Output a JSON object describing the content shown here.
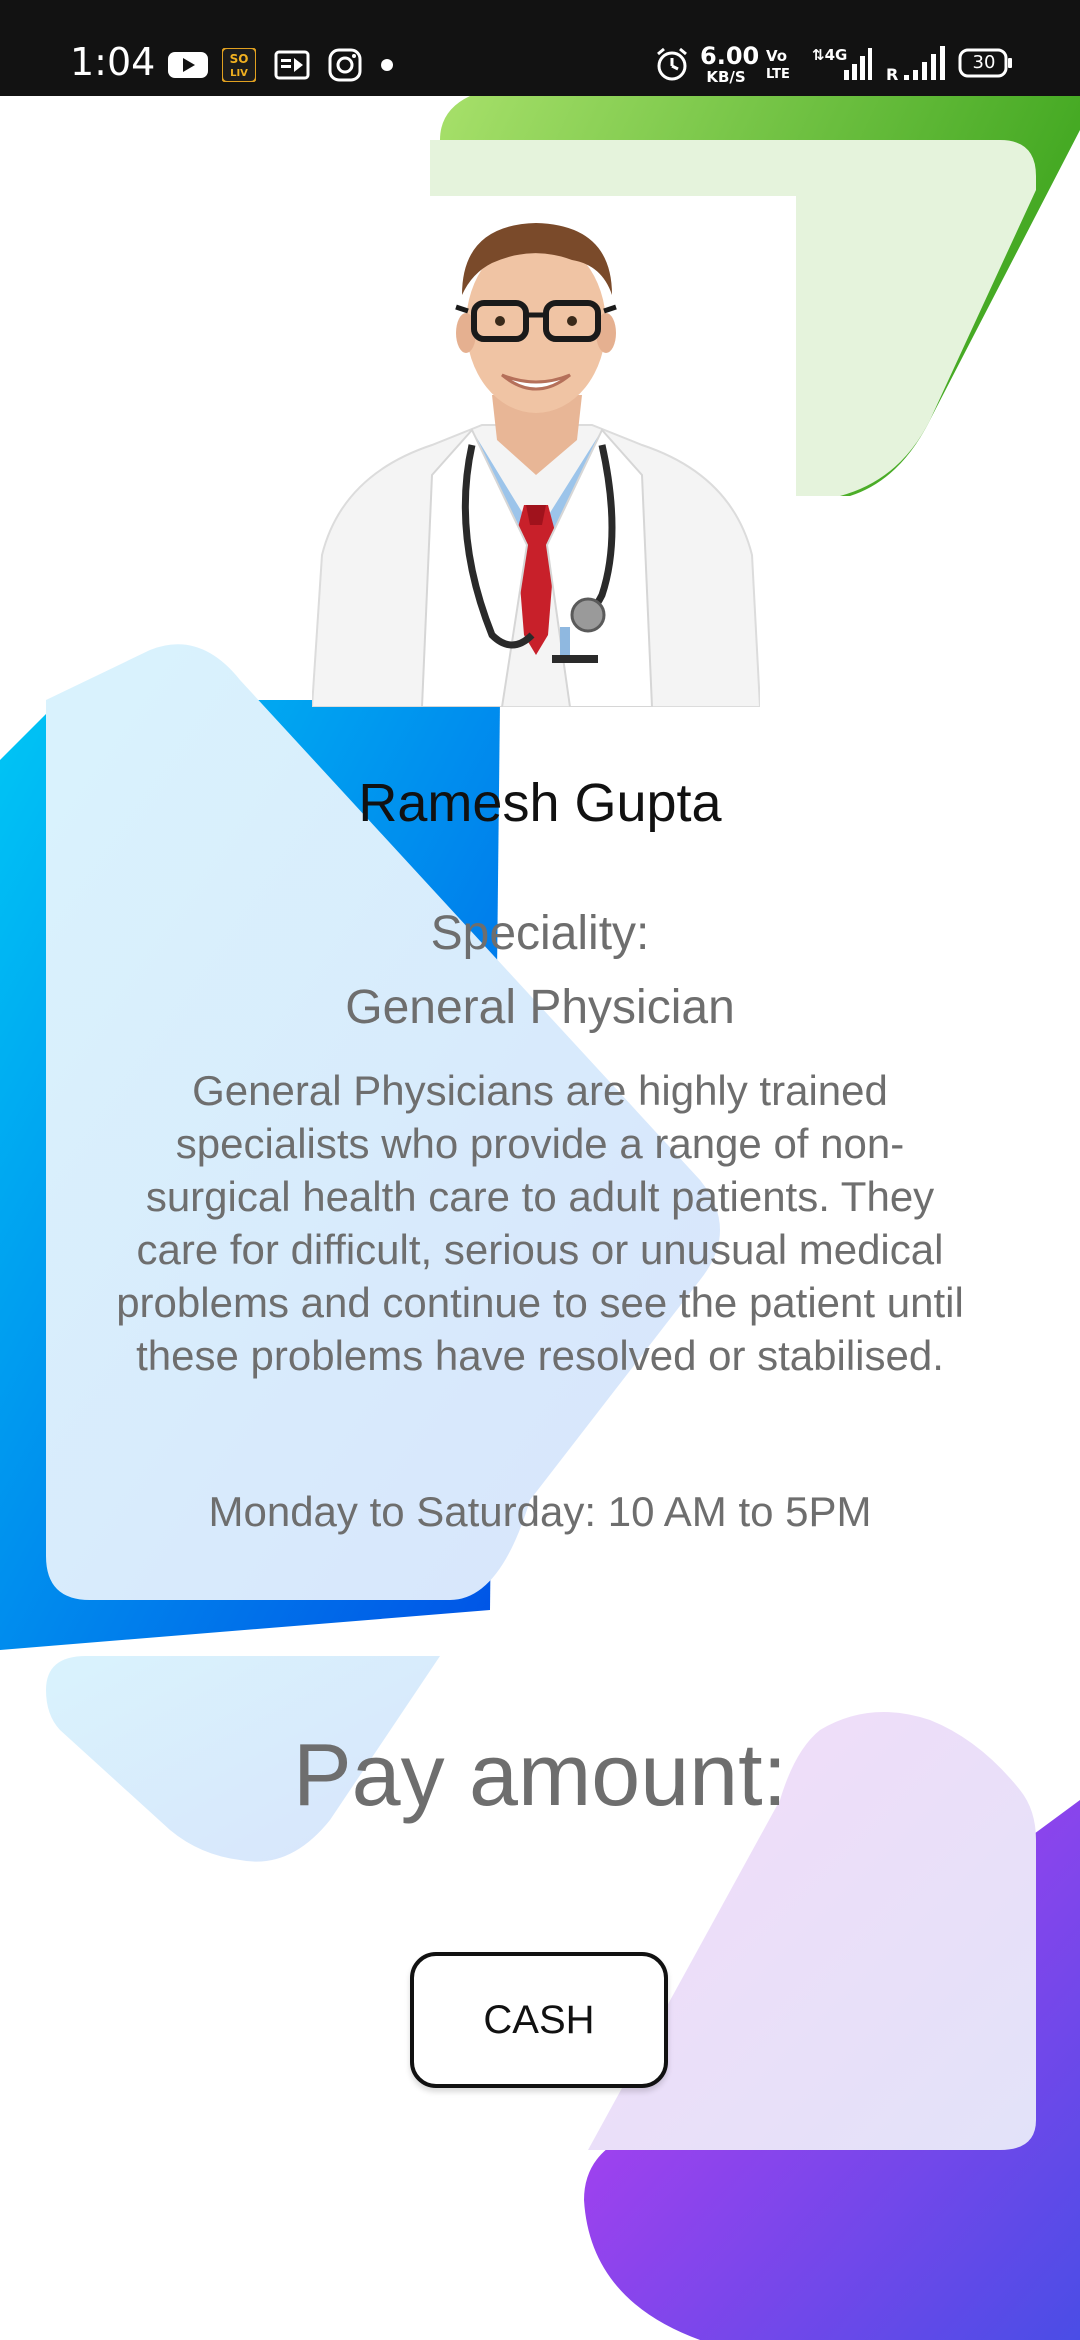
{
  "status_bar": {
    "time": "1:04",
    "network_speed_value": "6.00",
    "network_speed_unit": "KB/S",
    "volte_label": "Vo\nLTE",
    "network_type": "4G",
    "roaming_label": "R",
    "battery_level": "30"
  },
  "doctor": {
    "name": "Ramesh Gupta",
    "speciality_label": "Speciality:",
    "speciality": "General Physician",
    "description": "General Physicians are highly trained specialists who provide a range of non-surgical health care to adult patients. They care for difficult, serious or unusual medical problems and continue to see the patient until these problems have resolved or stabilised.",
    "hours": "Monday to Saturday: 10 AM to 5PM"
  },
  "payment": {
    "label": "Pay amount:",
    "cash_button": "CASH"
  },
  "colors": {
    "green_accent": "#5fbf2a",
    "blue_accent": "#0066e0",
    "purple_accent": "#8a3ff0",
    "text_gray": "#6e6e6e"
  }
}
